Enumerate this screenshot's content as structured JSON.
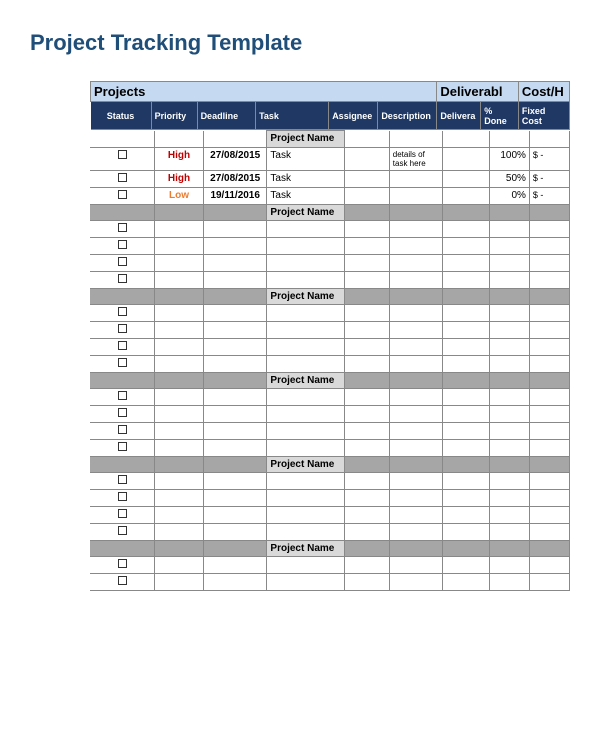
{
  "title": "Project Tracking Template",
  "groupHeaders": {
    "projects": "Projects",
    "deliverables": "Deliverabl",
    "cost": "Cost/H"
  },
  "columns": {
    "status": "Status",
    "priority": "Priority",
    "deadline": "Deadline",
    "task": "Task",
    "assignee": "Assignee",
    "description": "Description",
    "deliverable": "Delivera",
    "done": "% Done",
    "fixedcost": "Fixed Cost"
  },
  "sectionLabel": "Project Name",
  "rows": [
    {
      "priority": "High",
      "pclass": "high",
      "deadline": "27/08/2015",
      "task": "Task",
      "desc": "details of task here",
      "done": "100%",
      "cost": "$    -"
    },
    {
      "priority": "High",
      "pclass": "high",
      "deadline": "27/08/2015",
      "task": "Task",
      "desc": "",
      "done": "50%",
      "cost": "$    -"
    },
    {
      "priority": "Low",
      "pclass": "low",
      "deadline": "19/11/2016",
      "task": "Task",
      "desc": "",
      "done": "0%",
      "cost": "$    -"
    }
  ],
  "emptySections": [
    4,
    4,
    4,
    4,
    2
  ]
}
